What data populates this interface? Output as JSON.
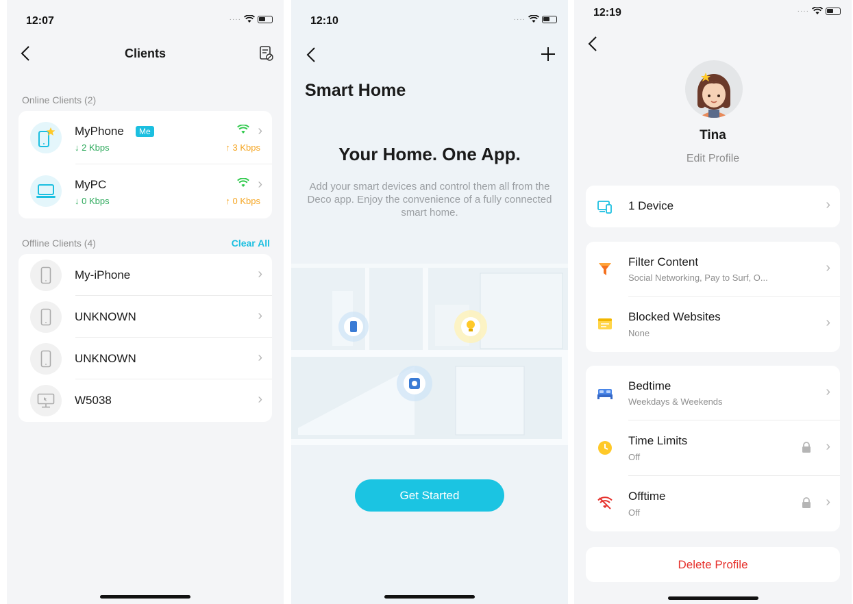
{
  "screen1": {
    "status_time": "12:07",
    "title": "Clients",
    "online_header": "Online Clients (2)",
    "online": [
      {
        "name": "MyPhone",
        "badge": "Me",
        "down": "↓ 2 Kbps",
        "up": "↑ 3 Kbps"
      },
      {
        "name": "MyPC",
        "down": "↓ 0 Kbps",
        "up": "↑ 0 Kbps"
      }
    ],
    "offline_header": "Offline Clients (4)",
    "clear_all": "Clear All",
    "offline": [
      {
        "name": "My-iPhone"
      },
      {
        "name": "UNKNOWN"
      },
      {
        "name": "UNKNOWN"
      },
      {
        "name": "W5038"
      }
    ]
  },
  "screen2": {
    "status_time": "12:10",
    "title": "Smart Home",
    "headline": "Your Home. One App.",
    "body": "Add your smart devices and control them all from the Deco app. Enjoy the convenience of a fully connected smart home.",
    "cta": "Get Started"
  },
  "screen3": {
    "status_time": "12:19",
    "profile_name": "Tina",
    "edit_profile": "Edit Profile",
    "device_row": "1 Device",
    "filter_title": "Filter Content",
    "filter_sub": "Social Networking, Pay to Surf, O...",
    "blocked_title": "Blocked Websites",
    "blocked_sub": "None",
    "bedtime_title": "Bedtime",
    "bedtime_sub": "Weekdays & Weekends",
    "time_limits_title": "Time Limits",
    "time_limits_sub": "Off",
    "offtime_title": "Offtime",
    "offtime_sub": "Off",
    "delete": "Delete Profile"
  },
  "colors": {
    "accent": "#1bbfe0",
    "wifi_green": "#2ec94b",
    "upload_orange": "#f5a623",
    "danger": "#e6322d"
  },
  "icons": [
    "back-chevron-icon",
    "blocklist-icon",
    "wifi-icon",
    "phone-icon",
    "pc-icon",
    "plus-icon",
    "lock-icon",
    "filter-icon",
    "bed-icon",
    "clock-icon",
    "wifi-off-icon"
  ]
}
